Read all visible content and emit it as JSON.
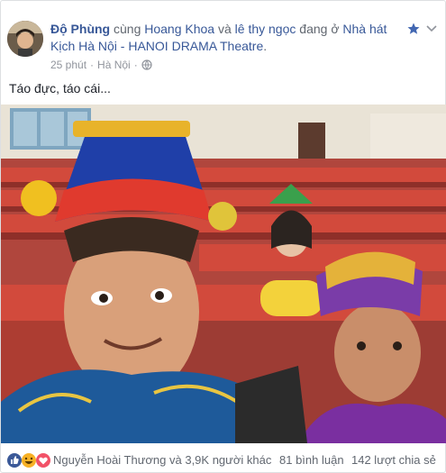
{
  "post": {
    "author": "Độ Phùng",
    "with_word": " cùng ",
    "tagged1": "Hoang Khoa",
    "and_word": " và ",
    "tagged2": "lê thy ngọc",
    "at_word": " đang ở ",
    "place": "Nhà hát Kịch Hà Nội - HANOI DRAMA Theatre",
    "period": ".",
    "time": "25 phút",
    "dot": "·",
    "location": "Hà Nội",
    "dot2": "·",
    "text": "Táo đực, táo cái..."
  },
  "icons": {
    "avatar": "avatar-photo",
    "star": "star-icon",
    "chevron": "chevron-down-icon",
    "privacy": "globe-icon",
    "reactions": [
      "like-icon",
      "haha-icon",
      "love-icon"
    ]
  },
  "footer": {
    "reactors": "Nguyễn Hoài Thương và 3,9K người khác",
    "comments": "81 bình luận",
    "shares": "142 lượt chia sẻ"
  },
  "colors": {
    "link": "#385898",
    "meta": "#90949c",
    "like": "#3b5998",
    "love": "#f25268",
    "haha": "#f7b125"
  }
}
